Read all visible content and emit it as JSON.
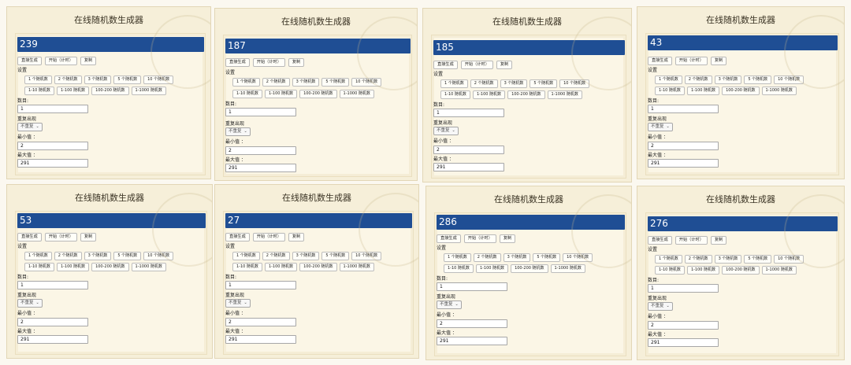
{
  "app": {
    "title": "在线随机数生成器",
    "buttons": {
      "direct": "直接生成",
      "timed": "开始（计时）",
      "copy": "复制"
    },
    "settings_label": "设置",
    "presets_count": [
      "1 个随机数",
      "2 个随机数",
      "3 个随机数",
      "5 个随机数",
      "10 个随机数"
    ],
    "presets_range": [
      "1-10 随机数",
      "1-100 随机数",
      "100-200 随机数",
      "1-1000 随机数"
    ],
    "count_label": "数目:",
    "repeat_label": "重复出现",
    "repeat_value": "不重复",
    "min_label": "最小值 ：",
    "max_label": "最大值 ："
  },
  "panels": [
    {
      "result": "239",
      "count": "1",
      "min": "2",
      "max": "291"
    },
    {
      "result": "187",
      "count": "1",
      "min": "2",
      "max": "291"
    },
    {
      "result": "185",
      "count": "1",
      "min": "2",
      "max": "291"
    },
    {
      "result": "43",
      "count": "1",
      "min": "2",
      "max": "291"
    },
    {
      "result": "53",
      "count": "1",
      "min": "2",
      "max": "291"
    },
    {
      "result": "27",
      "count": "1",
      "min": "2",
      "max": "291"
    },
    {
      "result": "286",
      "count": "1",
      "min": "2",
      "max": "291"
    },
    {
      "result": "276",
      "count": "1",
      "min": "2",
      "max": "291"
    }
  ],
  "colors": {
    "accent": "#1f4e94",
    "panel_bg": "#f6efd9",
    "page_bg": "#fbf8f0"
  }
}
